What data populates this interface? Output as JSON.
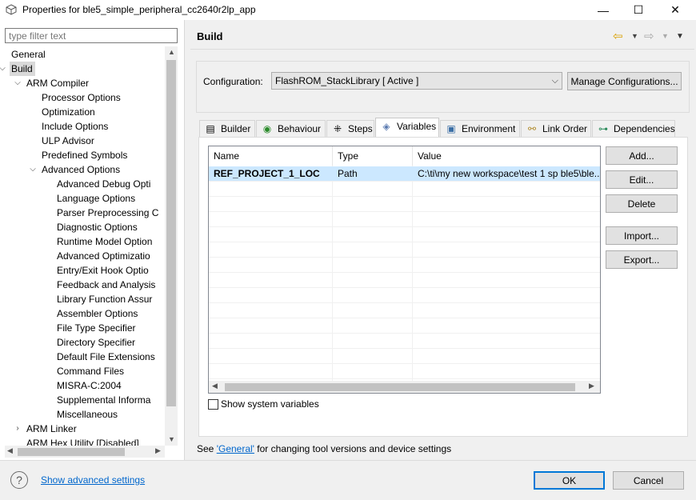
{
  "window": {
    "title": "Properties for ble5_simple_peripheral_cc2640r2lp_app",
    "minimize": "—",
    "maximize": "☐",
    "close": "✕"
  },
  "sidebar": {
    "filter_placeholder": "type filter text",
    "items": [
      {
        "label": "General",
        "level": 0
      },
      {
        "label": "Build",
        "level": 0,
        "expanded": true,
        "selected": true
      },
      {
        "label": "ARM Compiler",
        "level": 1,
        "expanded": true
      },
      {
        "label": "Processor Options",
        "level": 2
      },
      {
        "label": "Optimization",
        "level": 2
      },
      {
        "label": "Include Options",
        "level": 2
      },
      {
        "label": "ULP Advisor",
        "level": 2
      },
      {
        "label": "Predefined Symbols",
        "level": 2
      },
      {
        "label": "Advanced Options",
        "level": 2,
        "expanded": true
      },
      {
        "label": "Advanced Debug Opti",
        "level": 3
      },
      {
        "label": "Language Options",
        "level": 3
      },
      {
        "label": "Parser Preprocessing C",
        "level": 3
      },
      {
        "label": "Diagnostic Options",
        "level": 3
      },
      {
        "label": "Runtime Model Option",
        "level": 3
      },
      {
        "label": "Advanced Optimizatio",
        "level": 3
      },
      {
        "label": "Entry/Exit Hook Optio",
        "level": 3
      },
      {
        "label": "Feedback and Analysis",
        "level": 3
      },
      {
        "label": "Library Function Assur",
        "level": 3
      },
      {
        "label": "Assembler Options",
        "level": 3
      },
      {
        "label": "File Type Specifier",
        "level": 3
      },
      {
        "label": "Directory Specifier",
        "level": 3
      },
      {
        "label": "Default File Extensions",
        "level": 3
      },
      {
        "label": "Command Files",
        "level": 3
      },
      {
        "label": "MISRA-C:2004",
        "level": 3
      },
      {
        "label": "Supplemental Informa",
        "level": 3
      },
      {
        "label": "Miscellaneous",
        "level": 3
      },
      {
        "label": "ARM Linker",
        "level": 1,
        "collapsed": true
      },
      {
        "label": "ARM Hex Utility  [Disabled]",
        "level": 1
      }
    ]
  },
  "page": {
    "title": "Build",
    "configuration_label": "Configuration:",
    "configuration_value": "FlashROM_StackLibrary  [ Active ]",
    "manage_button": "Manage Configurations...",
    "tabs": [
      {
        "label": "Builder",
        "icon": "builder-icon"
      },
      {
        "label": "Behaviour",
        "icon": "behaviour-icon"
      },
      {
        "label": "Steps",
        "icon": "steps-icon"
      },
      {
        "label": "Variables",
        "icon": "variables-icon",
        "active": true
      },
      {
        "label": "Environment",
        "icon": "environment-icon"
      },
      {
        "label": "Link Order",
        "icon": "link-order-icon"
      },
      {
        "label": "Dependencies",
        "icon": "dependencies-icon"
      }
    ],
    "table": {
      "columns": [
        "Name",
        "Type",
        "Value"
      ],
      "rows": [
        {
          "name": "REF_PROJECT_1_LOC",
          "type": "Path",
          "value": "C:\\ti\\my new workspace\\test 1 sp ble5\\ble..."
        }
      ]
    },
    "buttons": {
      "add": "Add...",
      "edit": "Edit...",
      "delete": "Delete",
      "import": "Import...",
      "export": "Export..."
    },
    "show_system_variables": "Show system variables",
    "footer_prefix": "See ",
    "footer_link": "'General'",
    "footer_suffix": " for changing tool versions and device settings"
  },
  "bottom": {
    "help": "?",
    "advanced_link": "Show advanced settings",
    "ok": "OK",
    "cancel": "Cancel"
  },
  "colors": {
    "selection": "#cce8ff",
    "link": "#0066cc",
    "default_button_border": "#0078d7"
  }
}
